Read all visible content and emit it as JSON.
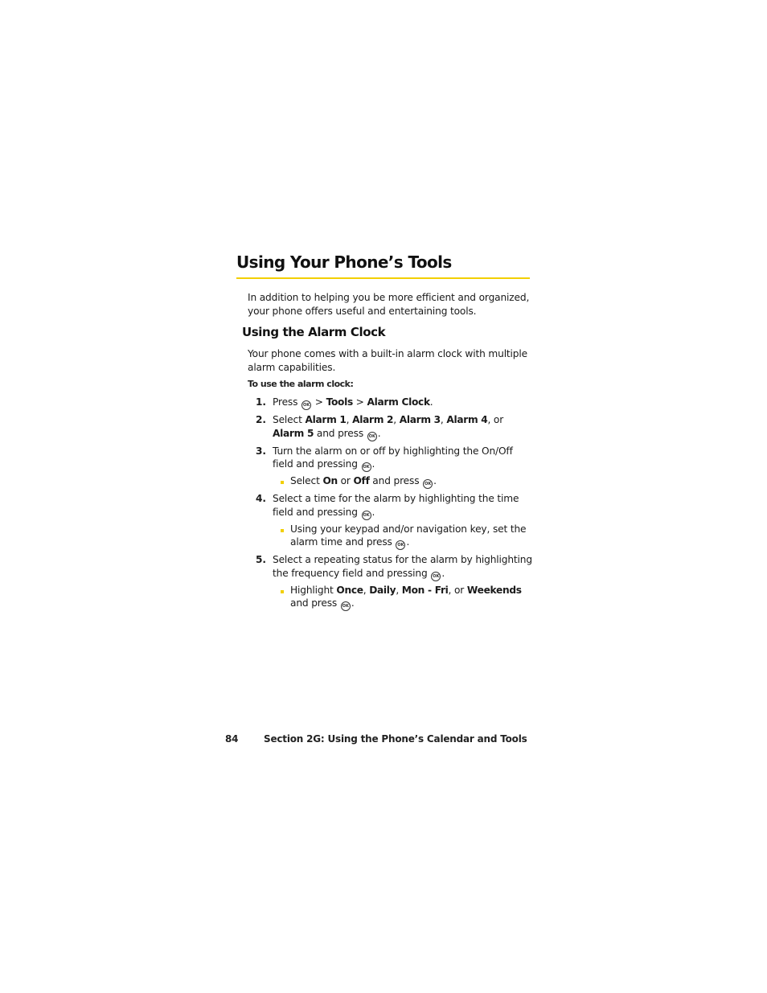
{
  "page": {
    "title": "Using Your Phone’s Tools",
    "intro": "In addition to helping you be more efficient and organized, your phone offers useful and entertaining tools.",
    "colors": {
      "accent": "#f2cf00"
    }
  },
  "alarm_section": {
    "title": "Using the Alarm Clock",
    "intro": "Your phone comes with a built-in alarm clock with multiple alarm capabilities.",
    "procedure_label": "To use the alarm clock:",
    "ok_icon_label": "OK",
    "steps": [
      {
        "num": "1.",
        "t1": "Press",
        "t2": " > ",
        "b1": "Tools",
        "t3": " > ",
        "b2": "Alarm Clock",
        "t4": "."
      },
      {
        "num": "2.",
        "t1": "Select ",
        "b1": "Alarm 1",
        "c1": ", ",
        "b2": "Alarm 2",
        "c2": ", ",
        "b3": "Alarm 3",
        "c3": ", ",
        "b4": "Alarm 4",
        "c4": ", or ",
        "b5": "Alarm 5",
        "t2": " and press ",
        "t3": "."
      },
      {
        "num": "3.",
        "t1": "Turn the alarm on or off by highlighting the On/Off field and pressing ",
        "t2": ".",
        "bullet": {
          "t1": "Select ",
          "b1": "On",
          "t2": " or ",
          "b2": "Off",
          "t3": " and press ",
          "t4": "."
        }
      },
      {
        "num": "4.",
        "t1": "Select a time for the alarm by highlighting the time field and pressing ",
        "t2": ".",
        "bullet": {
          "t1": "Using your keypad and/or navigation key, set the alarm time and press ",
          "t2": "."
        }
      },
      {
        "num": "5.",
        "t1": "Select a repeating status for the alarm by highlighting the frequency field and pressing ",
        "t2": ".",
        "bullet": {
          "t1": "Highlight ",
          "b1": "Once",
          "c1": ", ",
          "b2": "Daily",
          "c2": ", ",
          "b3": "Mon - Fri",
          "c3": ", or ",
          "b4": "Weekends",
          "t2": " and press ",
          "t3": "."
        }
      }
    ]
  },
  "footer": {
    "page_number": "84",
    "section": "Section 2G: Using the Phone’s Calendar and Tools"
  }
}
